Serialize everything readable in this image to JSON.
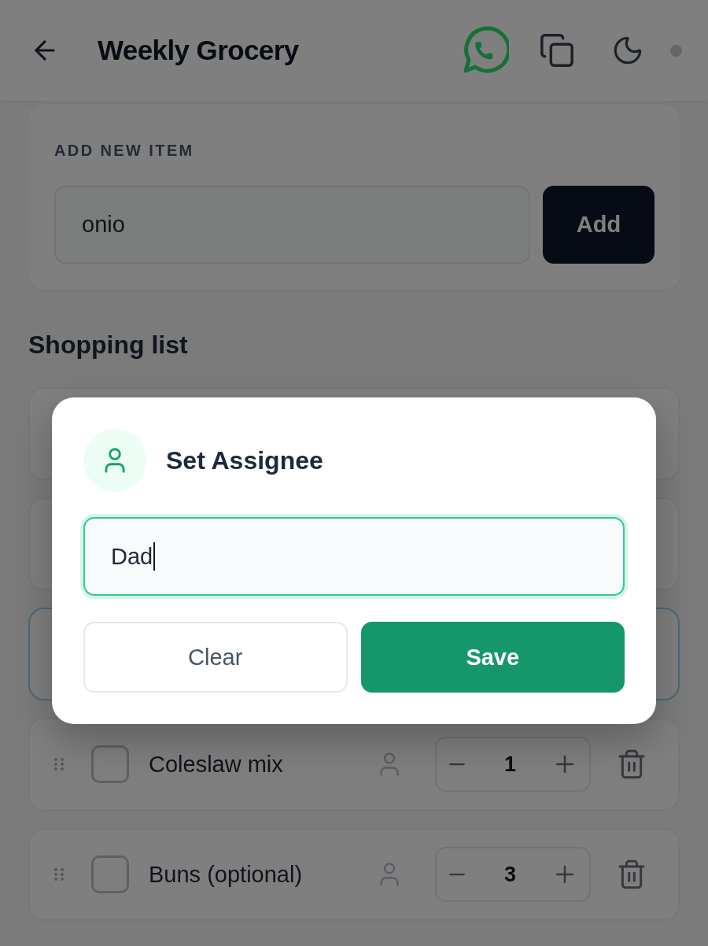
{
  "header": {
    "title": "Weekly Grocery"
  },
  "add_item": {
    "label": "ADD NEW ITEM",
    "input": {
      "value": "onio"
    },
    "button": "Add"
  },
  "list": {
    "heading": "Shopping list",
    "items": [
      {
        "selected": false
      },
      {
        "selected": false
      },
      {
        "selected": true
      },
      {
        "name": "Coleslaw mix",
        "checked": false,
        "selected": false,
        "quantity": "1"
      },
      {
        "name": "Buns (optional)",
        "checked": false,
        "selected": false,
        "quantity": "3"
      }
    ]
  },
  "dialog": {
    "title": "Set Assignee",
    "input": {
      "value": "Dad",
      "focused": true
    },
    "buttons": [
      {
        "label": "Clear",
        "kind": "secondary"
      },
      {
        "label": "Save",
        "kind": "primary"
      }
    ]
  }
}
